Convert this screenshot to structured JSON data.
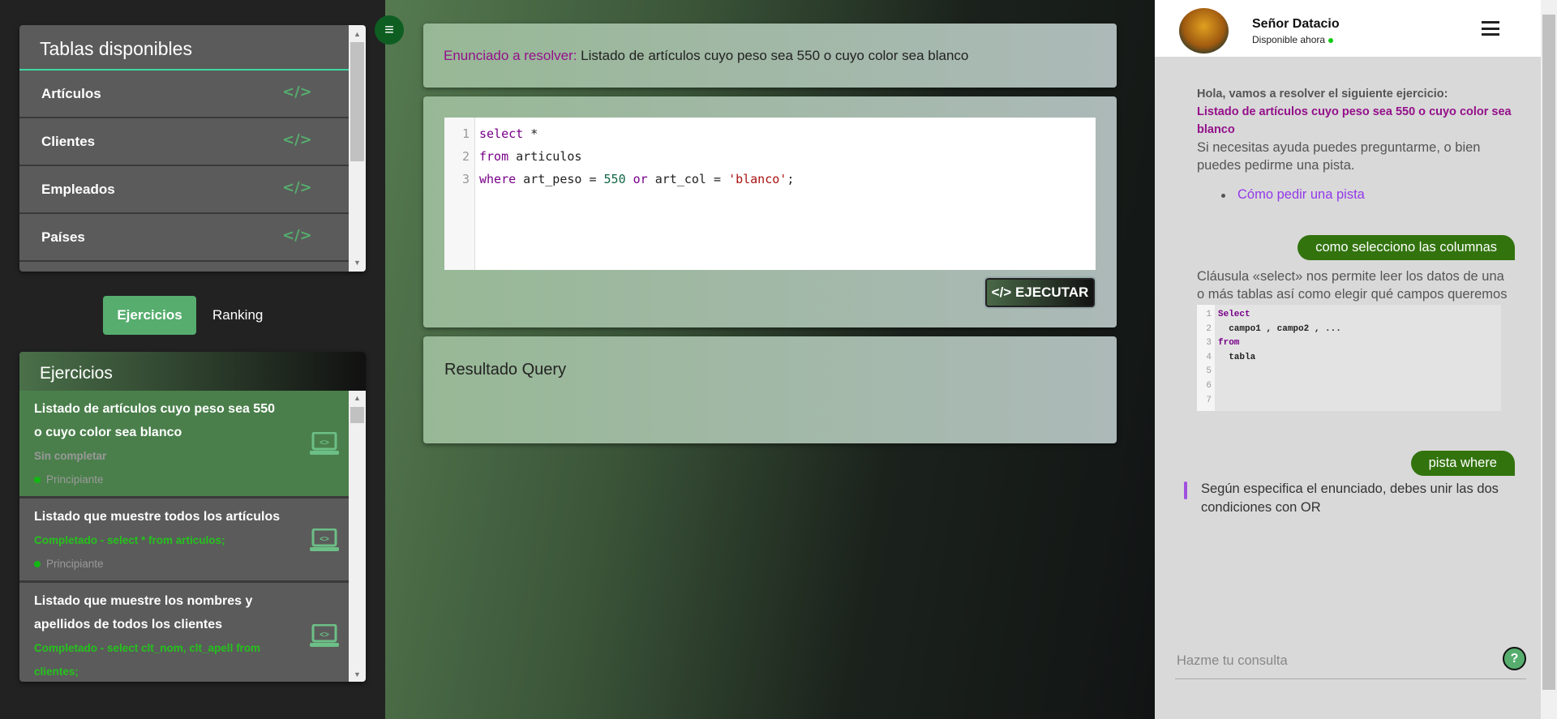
{
  "tables_panel": {
    "title": "Tablas disponibles",
    "items": [
      {
        "label": "Artículos"
      },
      {
        "label": "Clientes"
      },
      {
        "label": "Empleados"
      },
      {
        "label": "Países"
      }
    ],
    "code_icon": "</>"
  },
  "tabs": {
    "ejercicios": "Ejercicios",
    "ranking": "Ranking"
  },
  "exercises_panel": {
    "title": "Ejercicios",
    "items": [
      {
        "title": "Listado de artículos cuyo peso sea 550 o cuyo color sea blanco",
        "status": "Sin completar",
        "level": "Principiante"
      },
      {
        "title": "Listado que muestre todos los artículos",
        "status": "Completado - select * from articulos;",
        "level": "Principiante"
      },
      {
        "title": "Listado que muestre los nombres y apellidos de todos los clientes",
        "status": "Completado - select clt_nom, clt_apell from clientes;"
      }
    ]
  },
  "statement": {
    "label": "Enunciado a resolver:",
    "text": "Listado de artículos cuyo peso sea 550 o cuyo color sea blanco"
  },
  "editor": {
    "line_numbers": [
      "1",
      "2",
      "3"
    ],
    "lines": [
      [
        "select",
        " *"
      ],
      [
        "from",
        " articulos"
      ],
      [
        "where",
        " art_peso = ",
        "550",
        " or",
        " art_col = ",
        "'blanco'",
        ";"
      ]
    ]
  },
  "run_button": {
    "label": "EJECUTAR",
    "icon": "</>"
  },
  "result": {
    "title": "Resultado Query"
  },
  "bot": {
    "name": "Señor Datacio",
    "status": "Disponible ahora",
    "greeting": "Hola, vamos a resolver el siguiente ejercicio:",
    "exercise": "Listado de artículos cuyo peso sea 550 o cuyo color sea blanco",
    "help": "Si necesitas ayuda puedes preguntarme, o bien puedes pedirme una pista.",
    "link": "Cómo pedir una pista",
    "user_msg_1": "como selecciono las columnas",
    "reply_1": "Cláusula «select» nos permite leer los datos de una o más tablas así como elegir qué campos queremos que se muestren.",
    "snippet": {
      "line_numbers": [
        "1",
        "2",
        "3",
        "4",
        "5",
        "6",
        "7"
      ],
      "l1": "Select",
      "l2": "  campo1 , campo2 , ...",
      "l3": "from",
      "l4": "  tabla"
    },
    "user_msg_2": "pista where",
    "reply_2": "Según especifica el enunciado, debes unir las dos condiciones con OR",
    "input_placeholder": "Hazme tu consulta",
    "help_button": "?"
  },
  "colors": {
    "accent": "#56ad6e",
    "bubble": "#32730e",
    "purple": "#94108a"
  }
}
